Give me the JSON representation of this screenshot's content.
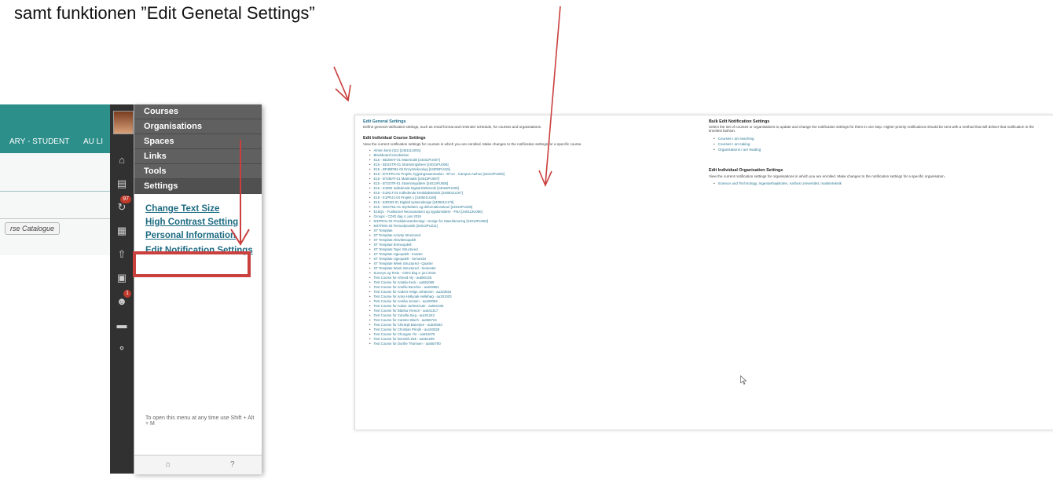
{
  "caption": "samt funktionen ”Edit Genetal Settings”",
  "left": {
    "header_left_text": "ARY - STUDENT",
    "header_right_text": "AU LI",
    "catalogue_button": "rse Catalogue",
    "rail_badges": [
      "97",
      "1"
    ],
    "menu_items": [
      "Courses",
      "Organisations",
      "Spaces",
      "Links",
      "Tools",
      "Settings"
    ],
    "settings_links": [
      "Change Text Size",
      "High Contrast Setting",
      "Personal Information",
      "Edit Notification Settings"
    ],
    "hint": "To open this menu at any time use Shift + Alt + M"
  },
  "right": {
    "general_title": "Edit General Settings",
    "general_desc": "Define general notification settings, such as email format and reminder schedule, for courses and organisations.",
    "course_title": "Edit Individual Course Settings",
    "course_desc": "View the current notification settings for courses in which you are enrolled. Make changes to the notification settings for a specific course.",
    "courses": [
      "Almen kemi (Q1) [245111U001]",
      "Blackboard introduktion",
      "E15 - BD2MAT-01 Matematik [24031PU007]",
      "E15 - BD2STR-01 Strømningslære [24031PU006]",
      "E15 - BP4BPM1-02 Enzymteknologi [24005PU115]",
      "E15 - BT1PRJ-01 Projekt, bygningsautomation - BT1A - Campus Aarhus [24013PU002]",
      "E15 - BT2MAT-01 Matematik [24013PU007]",
      "E15 - BT2STR-01 Strømningslære [24013PU006]",
      "E15 - E1IDE Indledende Digital Elektronik [24015PU029]",
      "E15 - E1IKLT-01 Indledende kredsløbsteknik [240501U167]",
      "E15 - E1PRJ1-03 Projekt 1 [240501U160]",
      "E15 - E2DSD-01 Digitalt systemdesign [240501U176]",
      "E15 - M2STD1-01 Styrkelære og deformationsteori [24013PU106]",
      "E15Q1 - Funktionel Neuroanatomi og sygdomslære - FNA [240112U060]",
      "Groups - CDIO dag 4. juni 2015",
      "M1PRO1-03 Produktionsteknologi - Design for Manufacturing [24013PU050]",
      "M4TRM1-03 Termodynamik [24014PU211]",
      "ST Template",
      "ST Template Activity Structured",
      "ST Template Aktivitetsopdelt",
      "ST Template Emneopdelt",
      "ST Template Topic Structured",
      "ST Template Ugeopdelt - Kvarter",
      "ST Template Ugeopdelt - Semester",
      "ST Template Week Structured - Quarter",
      "ST Template Week Structured - Semester",
      "Surveys og Tests - CDIO dag 4. juni 2015",
      "Test Course for Ahmed Aly - au550135",
      "Test Course for Amalia Keck - au551069",
      "Test Course for Amélie Beucher - au549661",
      "Test Course for Anders Helge Johansen - au323634",
      "Test Course for Anna Hollyoak Hellebøg - au301003",
      "Test Course for Annika Jensen - au320082",
      "Test Course for Aukse Jurkeviciute - au551030",
      "Test Course for Blanka Vrenczi - au541317",
      "Test Course for Camilla Sieg - au101243",
      "Test Course for Carsten Bloch - au555724",
      "Test Course for Chiranjit Banerjee - au549340",
      "Test Course for Christian Prinds - au193028",
      "Test Course for Chungan Yin - au551075",
      "Test Course for Dominik Zak - au551209",
      "Test Course for Dorthe Thomsen - au550780"
    ],
    "bulk_title": "Bulk Edit Notification Settings",
    "bulk_desc": "Select the set of courses or organisations to update and change the notification settings for them in one step. Higher-priority notifications should be sent with a method that will deliver that notification in the timeliest fashion.",
    "bulk_items": [
      "Courses I am teaching",
      "Courses I am taking",
      "Organisations I am leading"
    ],
    "org_title": "Edit Individual Organisation Settings",
    "org_desc": "View the current notification settings for organisations in which you are enrolled. Make changes to the notification settings for a specific organisation.",
    "org_items": [
      "Science and Technology, Ingeniørhøjskolen, Aarhus Universitet, maskinteknik"
    ]
  }
}
